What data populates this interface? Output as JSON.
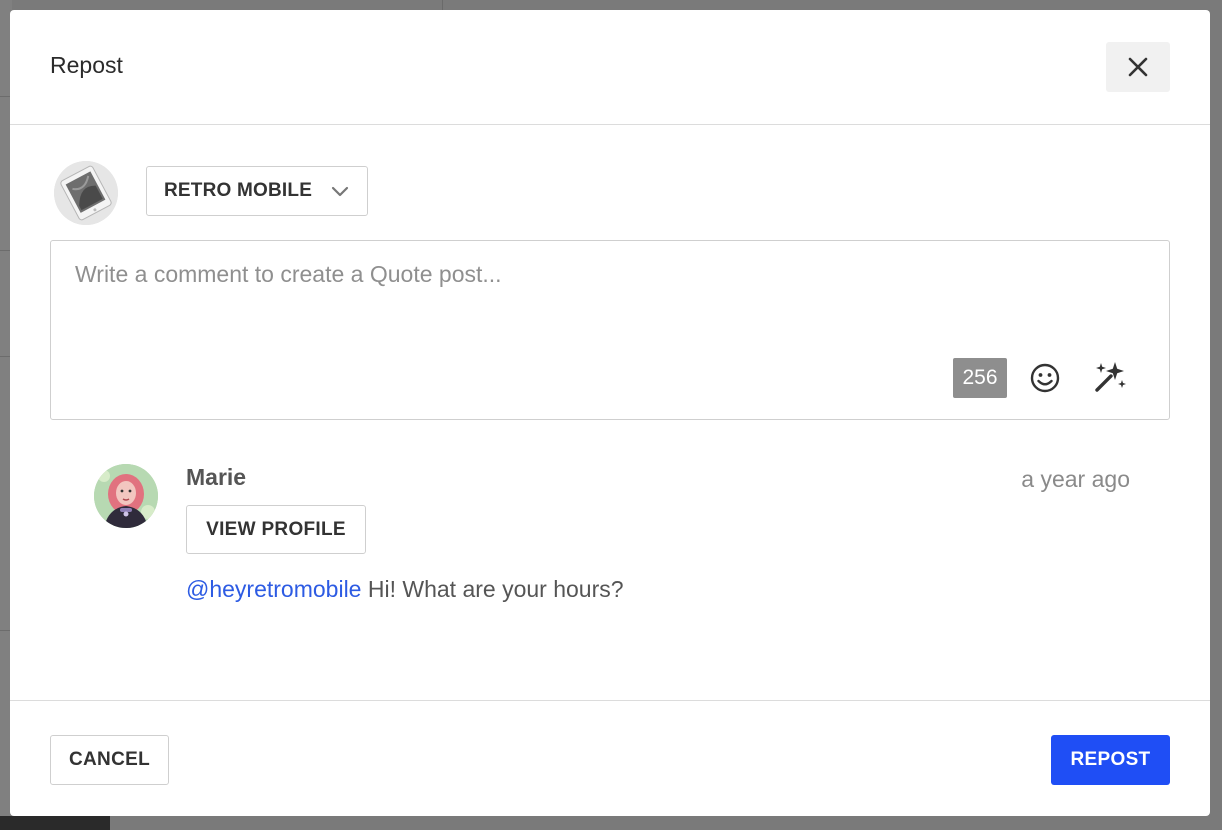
{
  "dialog": {
    "title": "Repost",
    "close_icon": "close-icon"
  },
  "account": {
    "name": "RETRO MOBILE",
    "dropdown_icon": "chevron-down-icon"
  },
  "comment": {
    "placeholder": "Write a comment to create a Quote post...",
    "value": "",
    "char_remaining": "256",
    "emoji_icon": "smiley-icon",
    "magic_icon": "magic-wand-icon"
  },
  "original_post": {
    "author": "Marie",
    "time": "a year ago",
    "view_profile_label": "VIEW PROFILE",
    "mention": "@heyretromobile",
    "text": " Hi! What are your hours?"
  },
  "footer": {
    "cancel_label": "CANCEL",
    "repost_label": "REPOST"
  },
  "colors": {
    "accent": "#1f4ef5",
    "mention": "#2d5be3",
    "counter_bg": "#8e8e8e"
  }
}
